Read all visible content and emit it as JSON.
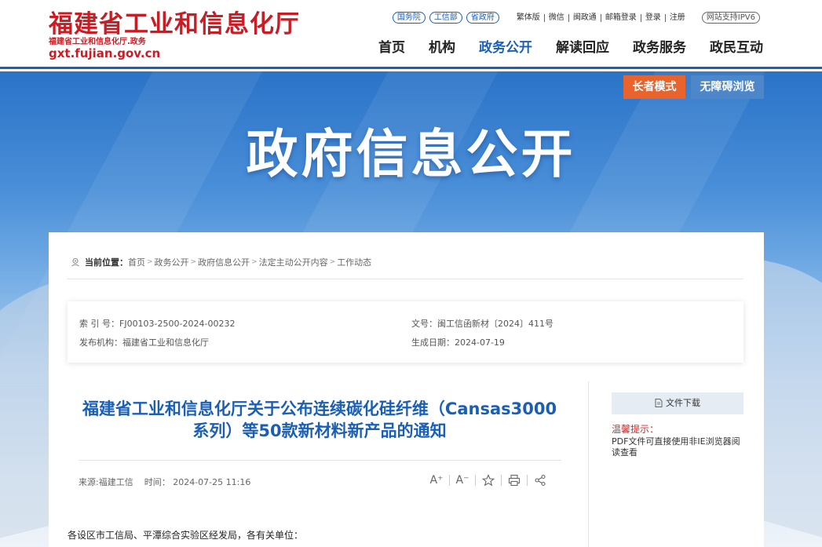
{
  "header": {
    "logo_title": "福建省工业和信息化厅",
    "logo_subtitle": "福建省工业和信息化厅.政务",
    "logo_url": "gxt.fujian.gov.cn",
    "pills": [
      "国务院",
      "工信部",
      "省政府"
    ],
    "links": [
      "繁体版",
      "微信",
      "闽政通",
      "邮箱登录",
      "登录",
      "注册"
    ],
    "ipv6": "网站支持IPV6",
    "nav": [
      "首页",
      "机构",
      "政务公开",
      "解读回应",
      "政务服务",
      "政民互动"
    ],
    "active_nav": "政务公开"
  },
  "banner": {
    "title": "政府信息公开",
    "elder_mode": "长者模式",
    "accessible": "无障碍浏览"
  },
  "breadcrumb": {
    "label": "当前位置：",
    "items": [
      "首页",
      "政务公开",
      "政府信息公开",
      "法定主动公开内容",
      "工作动态"
    ],
    "sep": ">"
  },
  "meta": {
    "index_no": "索 引 号：FJ00103-2500-2024-00232",
    "doc_no": "文号：闽工信函新材〔2024〕411号",
    "issuer": "发布机构：福建省工业和信息化厅",
    "date": "生成日期：2024-07-19"
  },
  "article": {
    "title_line1": "福建省工业和信息化厅关于公布连续碳化硅纤维（Cansas3000",
    "title_line2": "系列）等50款新材料新产品的通知",
    "source": "来源:福建工信",
    "time": "时间： 2024-07-25 11:16",
    "greeting": "各设区市工信局、平潭综合实验区经发局，各有关单位："
  },
  "tools": {
    "font_up": "A⁺",
    "font_down": "A⁻"
  },
  "sidebar": {
    "download": "文件下载",
    "tip_head": "温馨提示：",
    "tip_body": "PDF文件可直接使用非IE浏览器阅读查看"
  },
  "colors": {
    "brand_red": "#c81d24",
    "brand_blue": "#1b5fb4",
    "elder_orange": "#e8642c"
  }
}
